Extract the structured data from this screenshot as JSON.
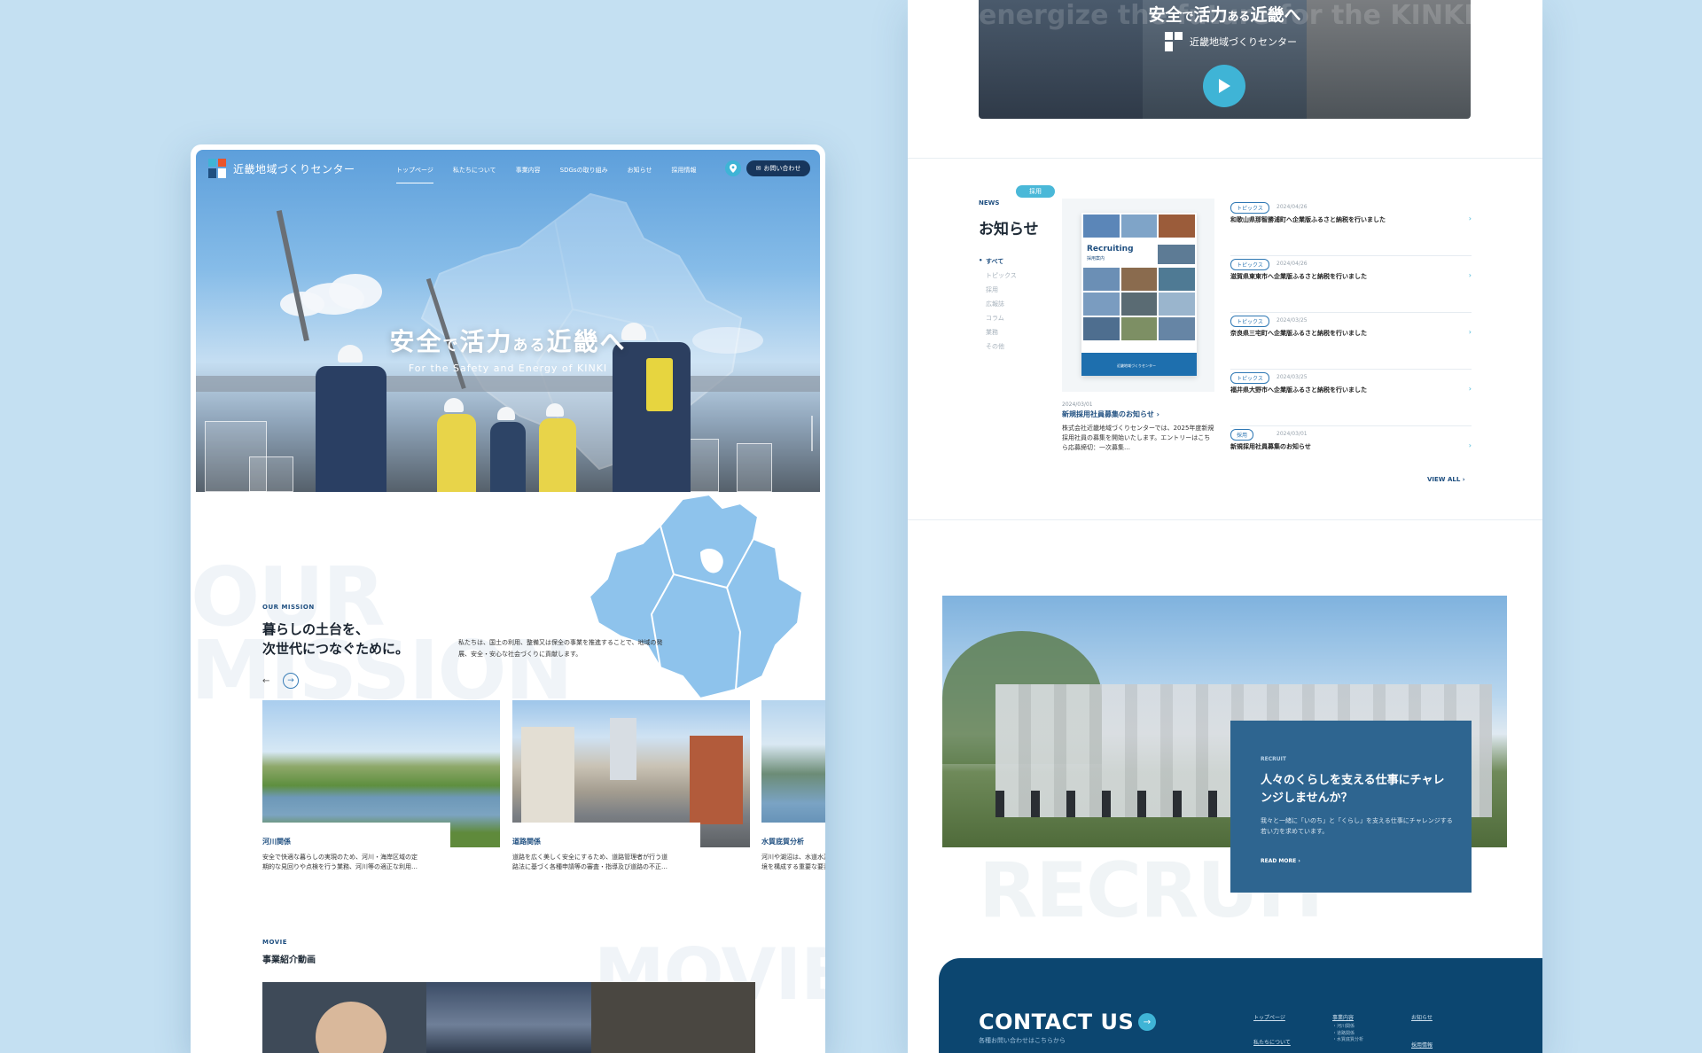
{
  "left_page": {
    "logo_text": "近畿地域づくりセンター",
    "nav": [
      "トップページ",
      "私たちについて",
      "事業内容",
      "SDGsの取り組み",
      "お知らせ",
      "採用情報"
    ],
    "contact_button": "お問い合わせ",
    "hero": {
      "title_a": "安全",
      "title_b": "で",
      "title_c": "活力",
      "title_d": "ある",
      "title_e": "近畿へ",
      "subtitle": "For the Safety and Energy of KINKI"
    },
    "mission": {
      "bg_word": "OUR MISSION",
      "label": "OUR MISSION",
      "title_line1": "暮らしの土台を、",
      "title_line2": "次世代につなぐために。",
      "text": "私たちは、国土の利用、整備又は保全の事業を推進することで、地域の発展、安全・安心な社会づくりに貢献します。",
      "prev": "←",
      "next": "→"
    },
    "cards": [
      {
        "title": "河川関係",
        "text": "安全で快適な暮らしの実現のため、河川・海岸区域の定期的な見回りや点検を行う業務、河川等の適正な利用…"
      },
      {
        "title": "道路関係",
        "text": "道路を広く美しく安全にするため、道路管理者が行う道路法に基づく各種申請等の審査・指導及び道路の不正…"
      },
      {
        "title": "水質底質分析",
        "text": "河川や湖沼は、水道水源として重要な役割を担い、水環境を構成する重要な要素となっている。…"
      }
    ],
    "movie": {
      "label": "MOVIE",
      "title": "事業紹介動画",
      "bg_word": "MOVIE"
    }
  },
  "right_page": {
    "video": {
      "bg_text": "energize the future for the KINKI",
      "title_a": "安全",
      "title_b": "で",
      "title_c": "活力",
      "title_d": "ある",
      "title_e": "近畿へ",
      "logo_text": "近畿地域づくりセンター"
    },
    "news": {
      "label": "NEWS",
      "title": "お知らせ",
      "categories": [
        "すべて",
        "トピックス",
        "採用",
        "広報誌",
        "コラム",
        "業務",
        "その他"
      ],
      "feature": {
        "cover_title": "Recruiting",
        "cover_sub": "採用案内",
        "cover_logo": "近畿地域づくりセンター",
        "badge": "採用",
        "date": "2024/03/01",
        "title": "新規採用社員募集のお知らせ",
        "text": "株式会社近畿地域づくりセンターでは、2025年度新規採用社員の募集を開始いたします。エントリーはこちら応募締切：一次募集…"
      },
      "items": [
        {
          "tag": "トピックス",
          "date": "2024/04/26",
          "text": "和歌山県那智勝浦町へ企業版ふるさと納税を行いました"
        },
        {
          "tag": "トピックス",
          "date": "2024/04/26",
          "text": "滋賀県東東市へ企業版ふるさと納税を行いました"
        },
        {
          "tag": "トピックス",
          "date": "2024/03/25",
          "text": "奈良県三宅町へ企業版ふるさと納税を行いました"
        },
        {
          "tag": "トピックス",
          "date": "2024/03/25",
          "text": "福井県大野市へ企業版ふるさと納税を行いました"
        },
        {
          "tag": "採用",
          "date": "2024/03/01",
          "text": "新規採用社員募集のお知らせ"
        }
      ],
      "view_all": "VIEW ALL"
    },
    "recruit": {
      "bg_word": "RECRUIT",
      "label": "RECRUIT",
      "title": "人々のくらしを支える仕事にチャレンジしませんか？",
      "text": "我々と一緒に「いのち」と「くらし」を支える仕事にチャレンジする若い力を求めています。",
      "more": "READ MORE"
    },
    "footer": {
      "contact_title": "CONTACT US",
      "contact_sub": "各種お問い合わせはこちらから",
      "nav_top": "トップページ",
      "nav_business": "事業内容",
      "nav_news": "お知らせ",
      "nav_about": "私たちについて",
      "nav_recruit": "採用情報",
      "business_sub": [
        "・河川関係",
        "・道路関係",
        "・水質底質分析"
      ]
    }
  }
}
